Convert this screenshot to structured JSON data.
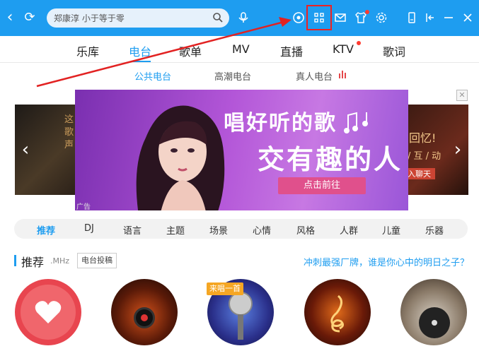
{
  "header": {
    "search_value": "郑康淳 小于等于零",
    "search_placeholder": "搜索"
  },
  "main_tabs": [
    "乐库",
    "电台",
    "歌单",
    "MV",
    "直播",
    "KTV",
    "歌词"
  ],
  "sub_tabs": [
    "公共电台",
    "高潮电台",
    "真人电台"
  ],
  "banner": {
    "line1": "唱好听的歌",
    "line2": "交有趣的人",
    "cta": "点击前往",
    "ad_label": "广告"
  },
  "side_left": {
    "line1": "这",
    "line2": "歌",
    "line3": "声"
  },
  "side_right": {
    "line1": "回忆!",
    "line2": "/ 互 / 动",
    "line3": "入聊天"
  },
  "categories": [
    "推荐",
    "DJ",
    "语言",
    "主题",
    "场景",
    "心情",
    "风格",
    "人群",
    "儿童",
    "乐器"
  ],
  "recommend": {
    "title": "推荐",
    "subtitle": ".MHz",
    "submit_button": "电台投稿",
    "promo_link": "冲刺最强厂牌，谁是你心中的明日之子？",
    "badge": "来唱一首"
  },
  "colors": {
    "accent": "#1e9df0",
    "top_bar": "#1e9df0",
    "highlight": "#e22222",
    "banner_cta": "#e0508c"
  }
}
